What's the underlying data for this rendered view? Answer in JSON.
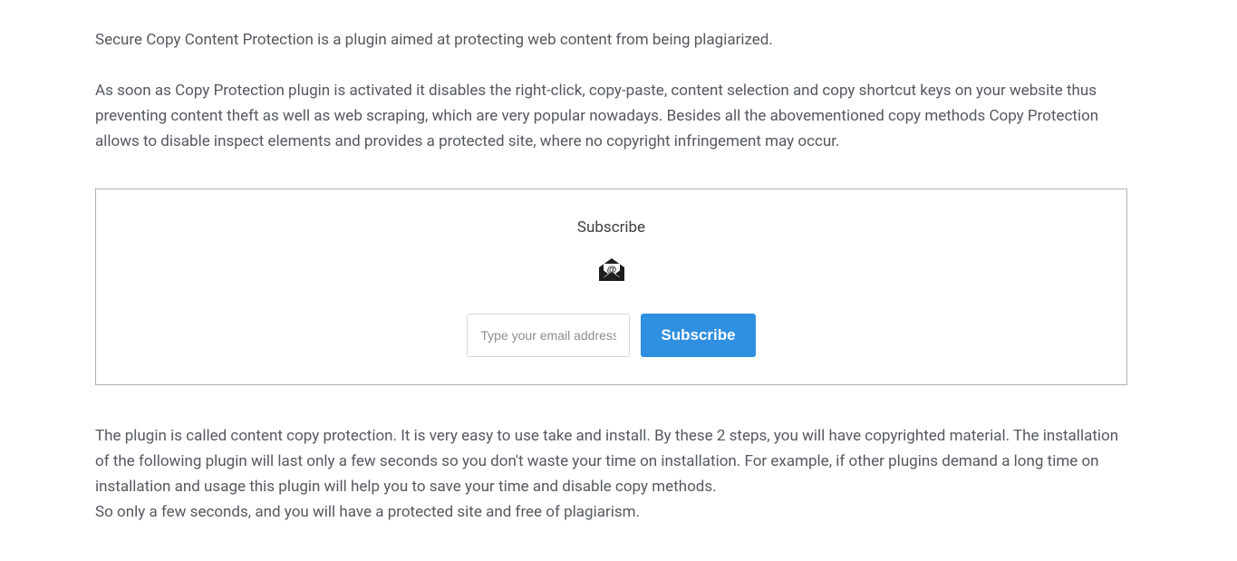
{
  "intro": "Secure Copy Content Protection is a plugin aimed at protecting web content from being plagiarized.",
  "desc": "As soon as Copy Protection plugin is activated it disables the right-click, copy-paste, content selection and copy shortcut keys on your website thus preventing content theft as well as web scraping, which are very popular nowadays. Besides all the abovementioned copy methods Copy Protection allows to disable inspect elements and provides a protected site, where no copyright infringement may occur.",
  "subscribe": {
    "title": "Subscribe",
    "placeholder": "Type your email address",
    "button": "Subscribe"
  },
  "outro1": "The plugin is called content copy protection. It is very easy to use take and install. By these 2 steps, you will have copyrighted material. The installation of the following plugin will last only a few seconds so you don't waste your time on installation. For example, if other plugins demand a long time on installation and usage this plugin will help you to save your time and disable copy methods.",
  "outro2": "So only a few seconds, and you will have a protected site and free of plagiarism."
}
